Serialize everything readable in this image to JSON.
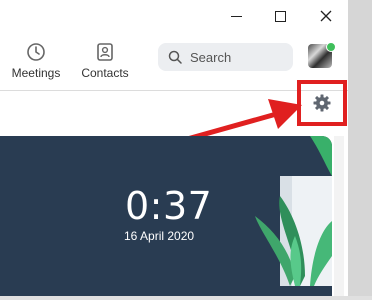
{
  "window": {
    "controls": {
      "minimize_icon": "minimize-icon",
      "maximize_icon": "maximize-icon",
      "close_icon": "close-icon"
    }
  },
  "nav": {
    "meetings": {
      "label": "Meetings",
      "icon": "clock-icon"
    },
    "contacts": {
      "label": "Contacts",
      "icon": "contact-card-icon"
    }
  },
  "search": {
    "placeholder": "Search",
    "icon": "search-icon"
  },
  "user": {
    "avatar": "avatar",
    "status_color": "#3fbf5b"
  },
  "settings": {
    "icon": "gear-icon",
    "highlight_color": "#e02020"
  },
  "home_card": {
    "time": "0:37",
    "date": "16 April 2020",
    "background_color": "#293c52"
  }
}
